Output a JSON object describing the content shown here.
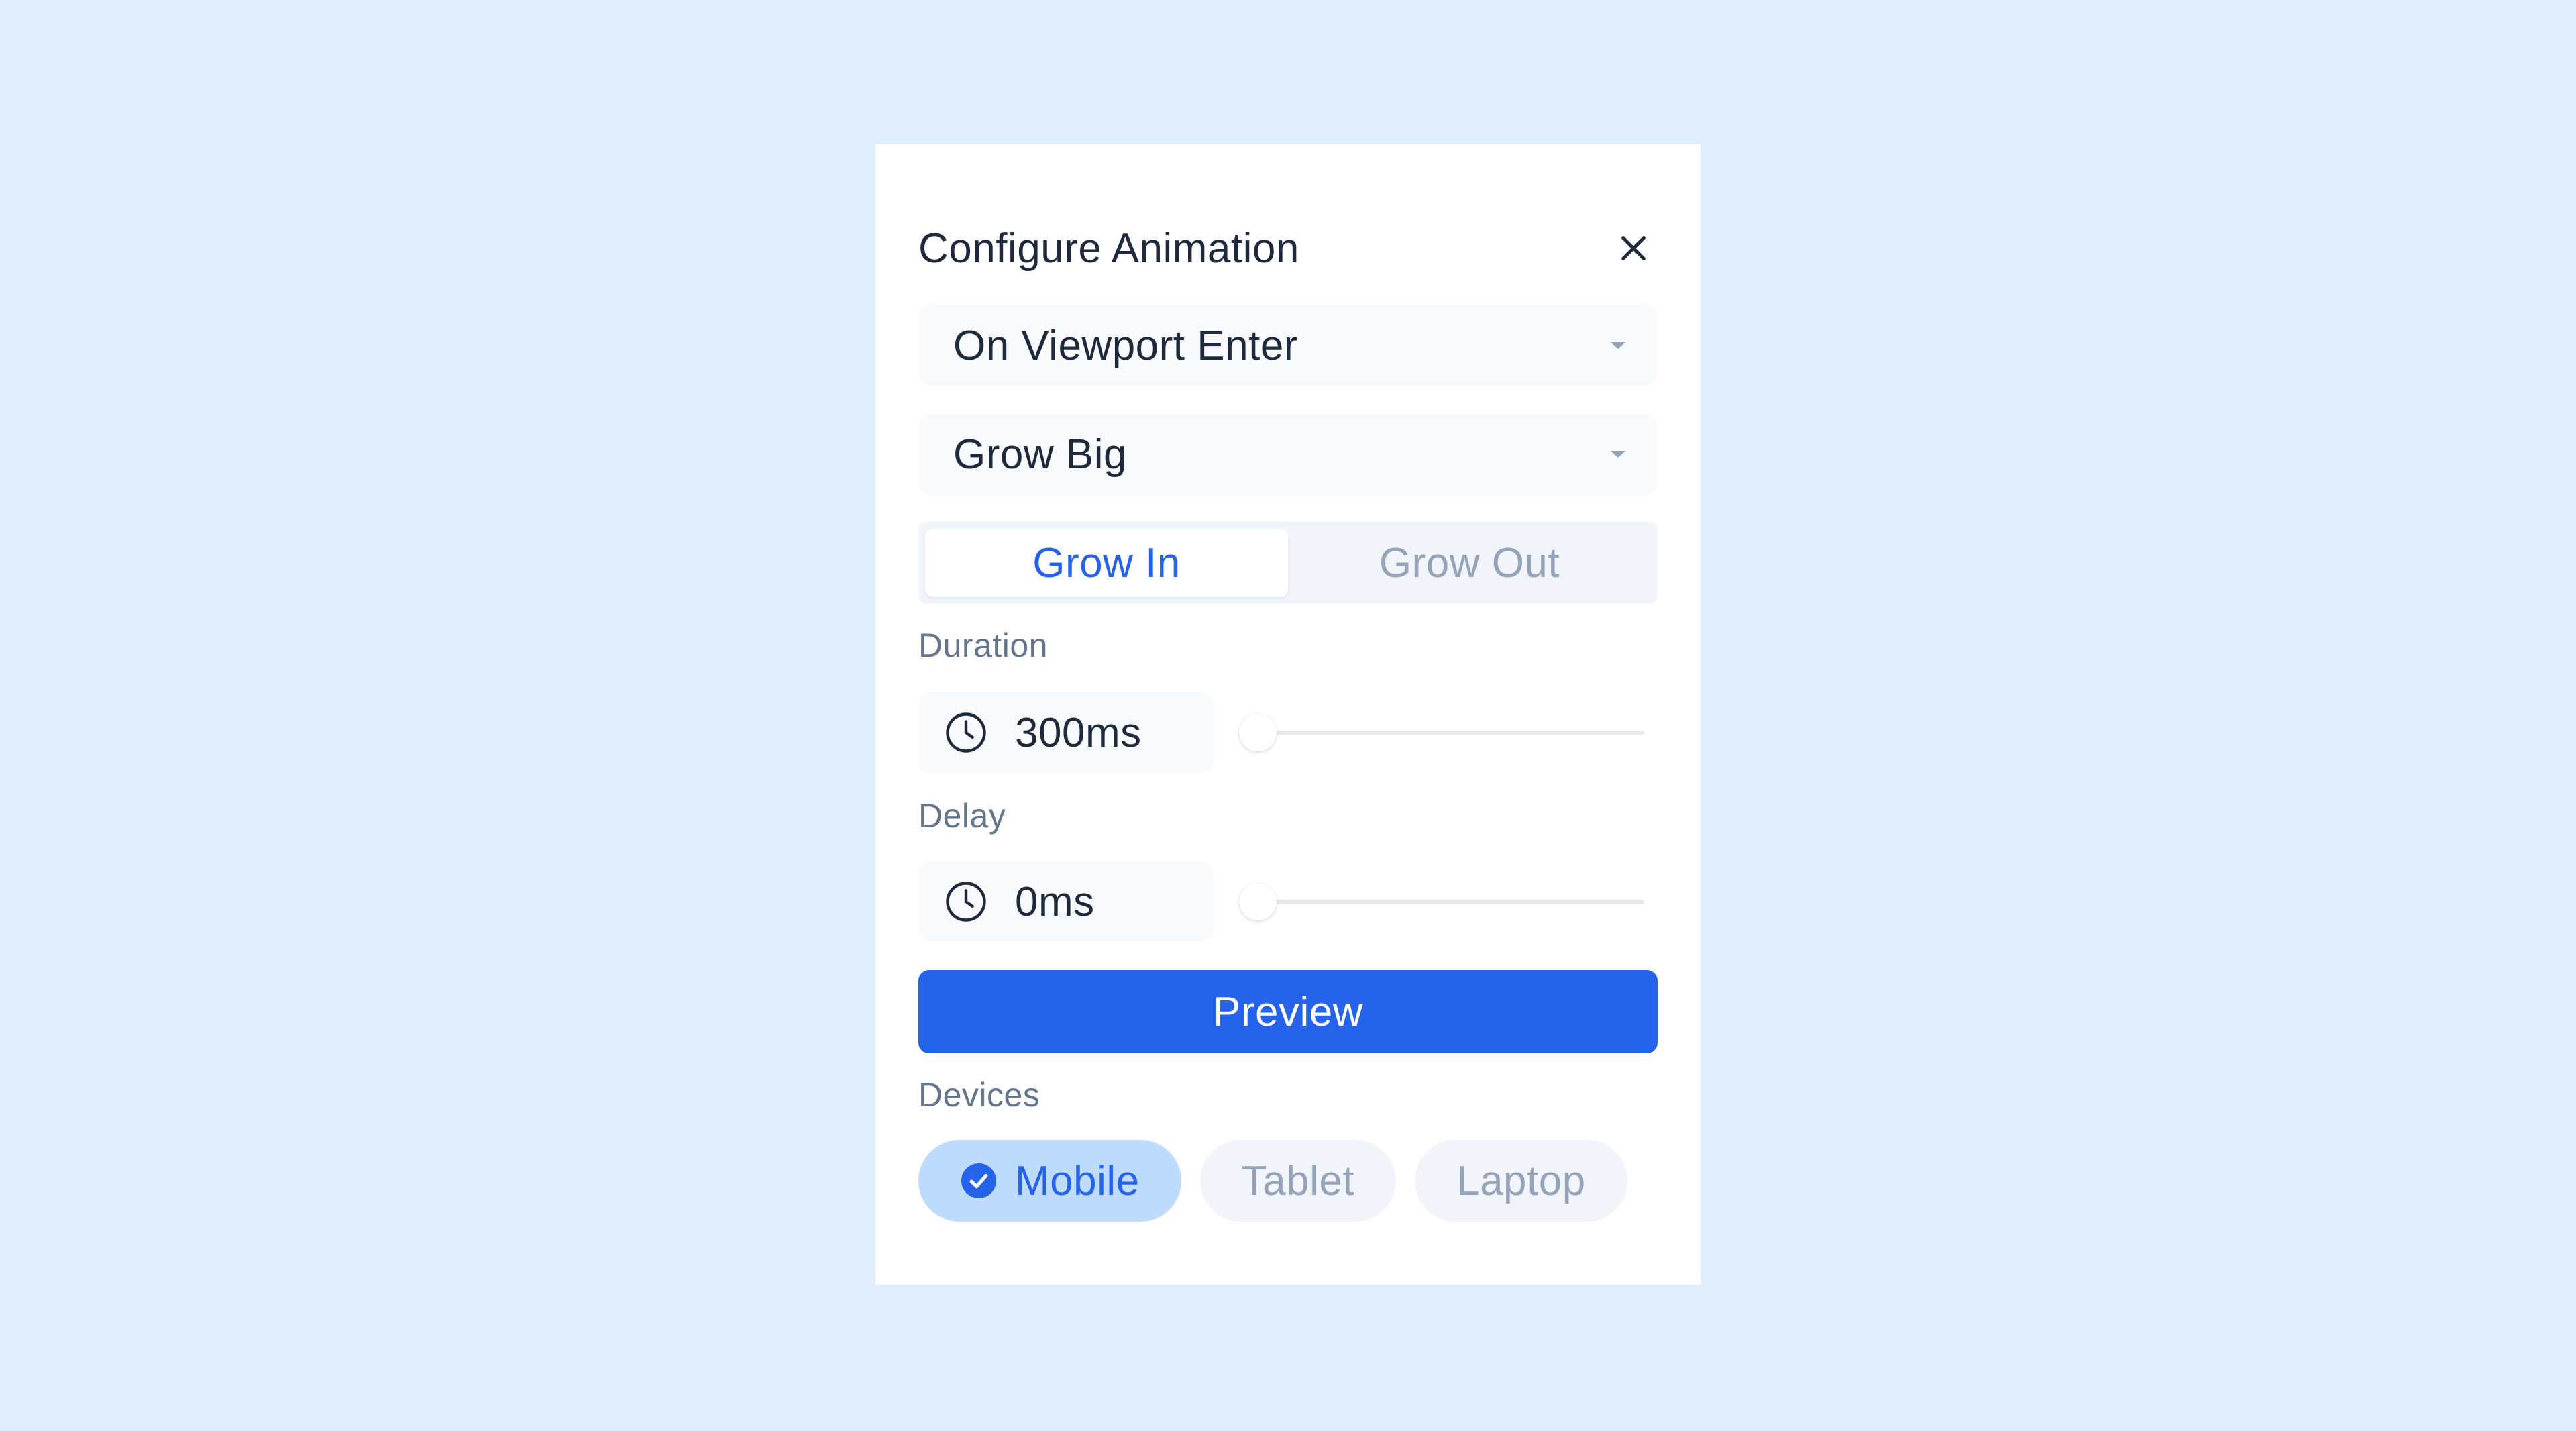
{
  "dialog": {
    "title": "Configure Animation",
    "close_icon": "close-icon"
  },
  "trigger_select": {
    "value": "On Viewport Enter",
    "icon": "chevron-down-icon"
  },
  "effect_select": {
    "value": "Grow Big",
    "icon": "chevron-down-icon"
  },
  "direction_toggle": {
    "options": [
      {
        "label": "Grow In",
        "active": true
      },
      {
        "label": "Grow Out",
        "active": false
      }
    ]
  },
  "duration": {
    "label": "Duration",
    "value": "300ms",
    "icon": "clock-icon",
    "slider_fraction": 0.0
  },
  "delay": {
    "label": "Delay",
    "value": "0ms",
    "icon": "clock-icon",
    "slider_fraction": 0.0
  },
  "preview_button": {
    "label": "Preview"
  },
  "devices": {
    "label": "Devices",
    "items": [
      {
        "label": "Mobile",
        "selected": true,
        "icon": "check-circle-icon"
      },
      {
        "label": "Tablet",
        "selected": false
      },
      {
        "label": "Laptop",
        "selected": false
      }
    ]
  },
  "colors": {
    "background": "#e0edfd",
    "accent": "#2563eb",
    "selected_chip": "#bfdbfe",
    "text_primary": "#1e293b",
    "text_muted": "#94a3b8",
    "label": "#64748b"
  }
}
